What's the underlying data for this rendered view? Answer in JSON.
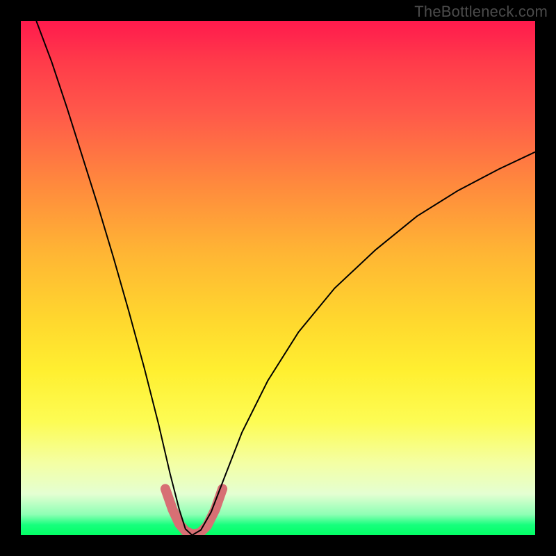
{
  "watermark": "TheBottleneck.com",
  "chart_data": {
    "type": "line",
    "title": "",
    "xlabel": "",
    "ylabel": "",
    "xlim": [
      0,
      1
    ],
    "ylim": [
      0,
      1
    ],
    "gradient_stops": [
      {
        "pos": 0.0,
        "color": "#ff1a4d"
      },
      {
        "pos": 0.18,
        "color": "#ff594a"
      },
      {
        "pos": 0.45,
        "color": "#ffb534"
      },
      {
        "pos": 0.68,
        "color": "#ffef30"
      },
      {
        "pos": 0.86,
        "color": "#f4ffa4"
      },
      {
        "pos": 0.96,
        "color": "#8dffb4"
      },
      {
        "pos": 1.0,
        "color": "#02ff65"
      }
    ],
    "curve_minimum_x": 0.33,
    "series": [
      {
        "name": "bottleneck-curve-left",
        "stroke": "#000000",
        "stroke_width": 2,
        "points": [
          {
            "x": 0.03,
            "y": 1.0
          },
          {
            "x": 0.06,
            "y": 0.92
          },
          {
            "x": 0.09,
            "y": 0.83
          },
          {
            "x": 0.12,
            "y": 0.735
          },
          {
            "x": 0.15,
            "y": 0.64
          },
          {
            "x": 0.18,
            "y": 0.54
          },
          {
            "x": 0.21,
            "y": 0.435
          },
          {
            "x": 0.24,
            "y": 0.325
          },
          {
            "x": 0.268,
            "y": 0.215
          },
          {
            "x": 0.29,
            "y": 0.12
          },
          {
            "x": 0.308,
            "y": 0.05
          },
          {
            "x": 0.32,
            "y": 0.012
          },
          {
            "x": 0.333,
            "y": 0.0
          }
        ]
      },
      {
        "name": "bottleneck-curve-right",
        "stroke": "#000000",
        "stroke_width": 2,
        "points": [
          {
            "x": 0.333,
            "y": 0.0
          },
          {
            "x": 0.35,
            "y": 0.01
          },
          {
            "x": 0.37,
            "y": 0.045
          },
          {
            "x": 0.395,
            "y": 0.11
          },
          {
            "x": 0.43,
            "y": 0.2
          },
          {
            "x": 0.48,
            "y": 0.3
          },
          {
            "x": 0.54,
            "y": 0.395
          },
          {
            "x": 0.61,
            "y": 0.48
          },
          {
            "x": 0.69,
            "y": 0.555
          },
          {
            "x": 0.77,
            "y": 0.62
          },
          {
            "x": 0.85,
            "y": 0.67
          },
          {
            "x": 0.93,
            "y": 0.712
          },
          {
            "x": 1.0,
            "y": 0.745
          }
        ]
      },
      {
        "name": "trough-marker",
        "stroke": "#d76f74",
        "stroke_width": 14,
        "linecap": "round",
        "points": [
          {
            "x": 0.281,
            "y": 0.09
          },
          {
            "x": 0.295,
            "y": 0.05
          },
          {
            "x": 0.308,
            "y": 0.022
          },
          {
            "x": 0.32,
            "y": 0.008
          },
          {
            "x": 0.333,
            "y": 0.002
          },
          {
            "x": 0.348,
            "y": 0.004
          },
          {
            "x": 0.362,
            "y": 0.018
          },
          {
            "x": 0.378,
            "y": 0.05
          },
          {
            "x": 0.392,
            "y": 0.09
          }
        ]
      }
    ]
  }
}
